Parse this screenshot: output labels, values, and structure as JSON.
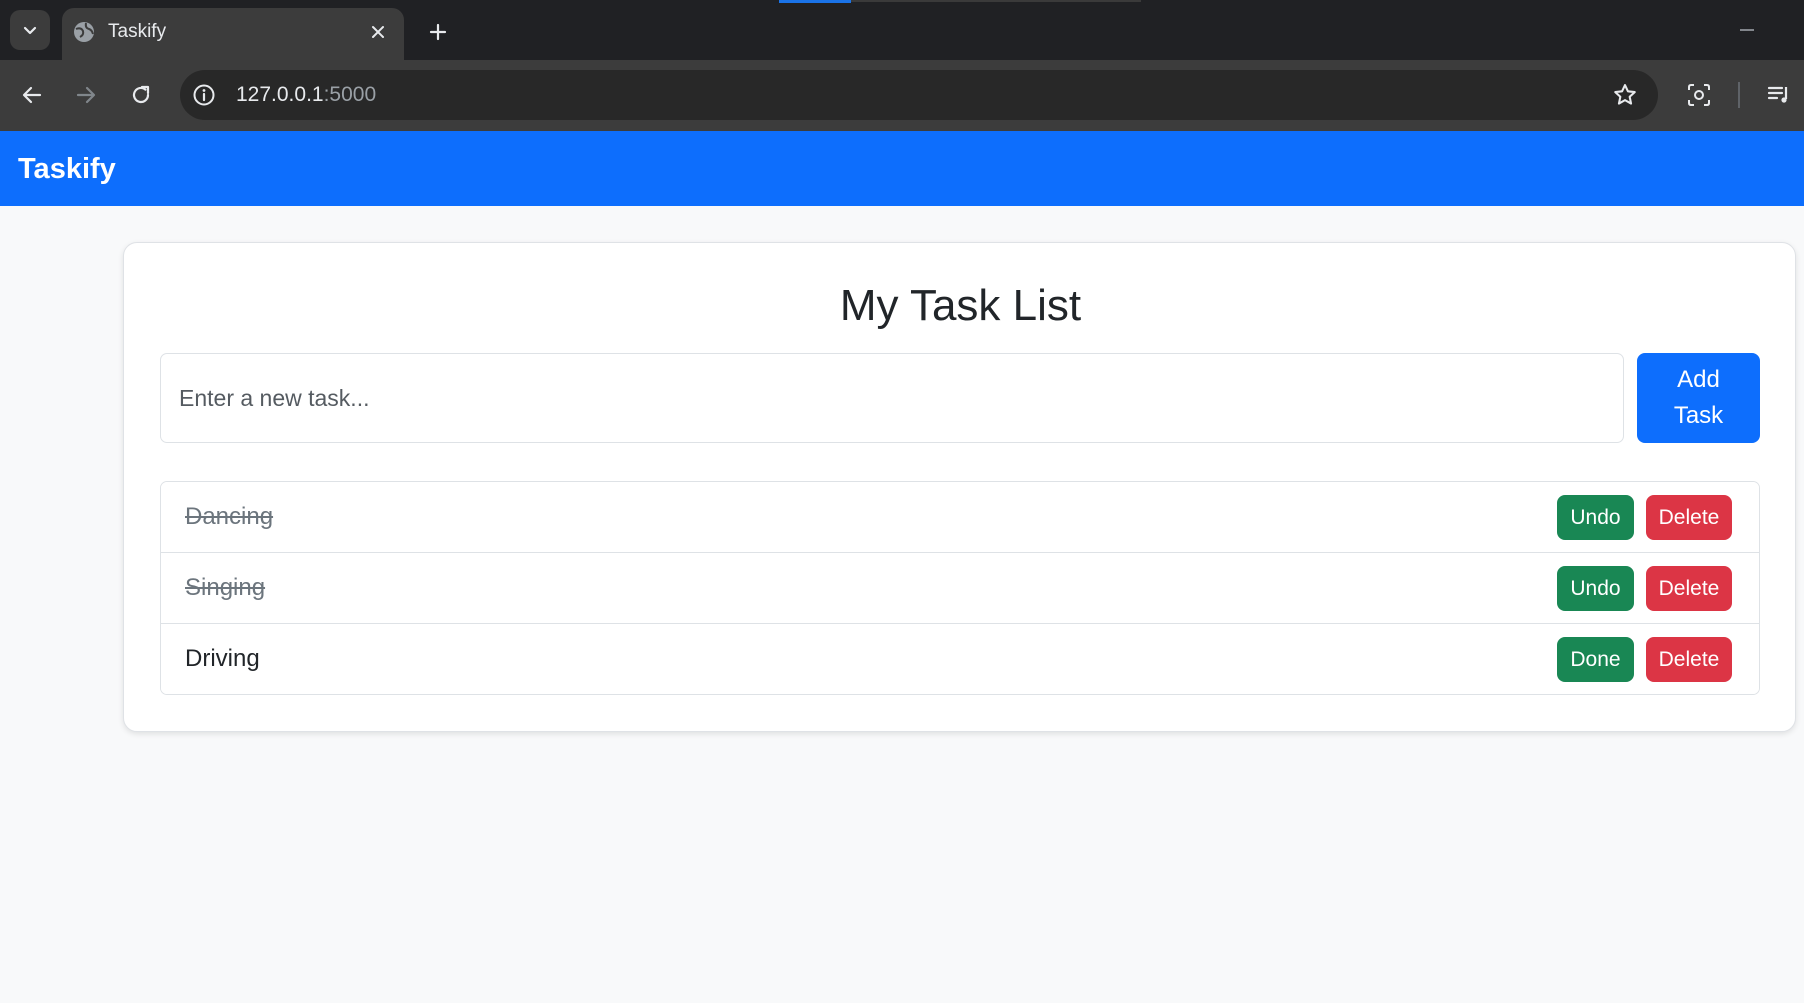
{
  "browser": {
    "tab_title": "Taskify",
    "url_host": "127.0.0.1",
    "url_port": ":5000"
  },
  "app": {
    "brand": "Taskify",
    "title": "My Task List",
    "input_placeholder": "Enter a new task...",
    "add_button_label": "Add Task"
  },
  "tasks": [
    {
      "text": "Dancing",
      "completed": true,
      "toggle_label": "Undo",
      "delete_label": "Delete"
    },
    {
      "text": "Singing",
      "completed": true,
      "toggle_label": "Undo",
      "delete_label": "Delete"
    },
    {
      "text": "Driving",
      "completed": false,
      "toggle_label": "Done",
      "delete_label": "Delete"
    }
  ],
  "colors": {
    "primary": "#0d6efd",
    "success": "#198754",
    "danger": "#dc3545"
  }
}
